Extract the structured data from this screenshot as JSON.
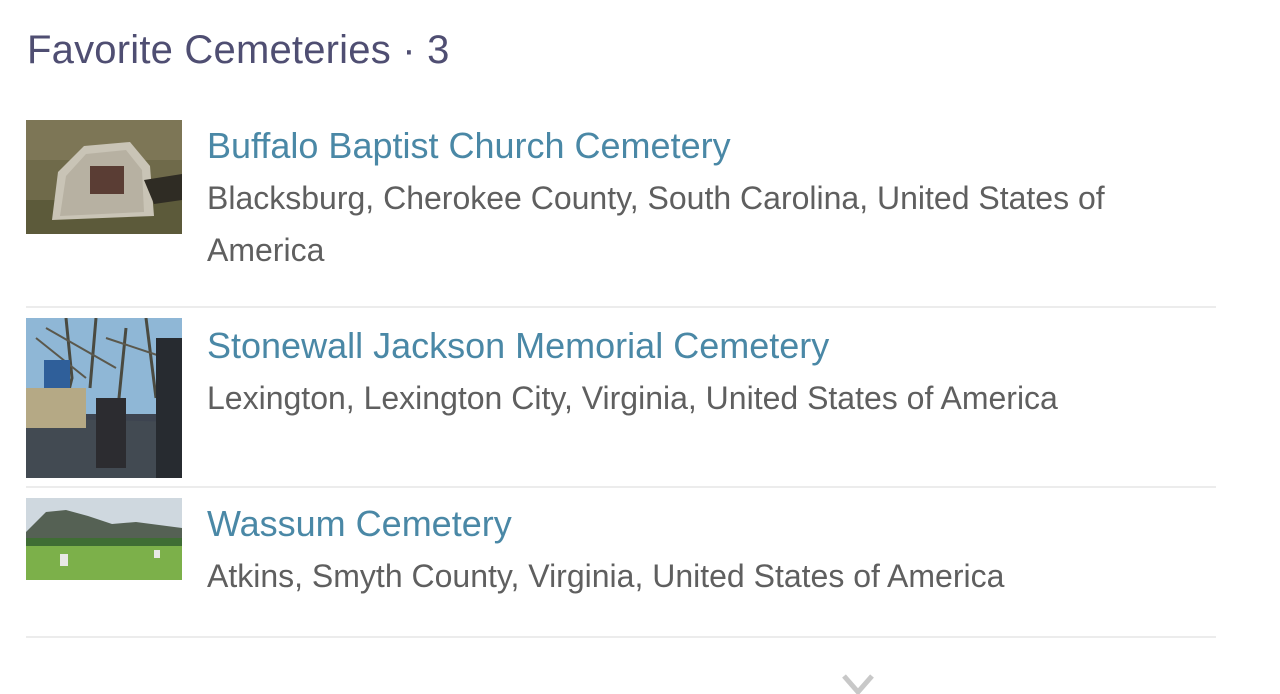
{
  "section": {
    "title": "Favorite Cemeteries",
    "separator": " · ",
    "count": "3"
  },
  "cemeteries": [
    {
      "name": "Buffalo Baptist Church Cemetery",
      "location": "Blacksburg, Cherokee County, South Carolina, United States of America",
      "thumbnail": "cemetery-photo"
    },
    {
      "name": "Stonewall Jackson Memorial Cemetery",
      "location": "Lexington, Lexington City, Virginia, United States of America",
      "thumbnail": "cemetery-photo"
    },
    {
      "name": "Wassum Cemetery",
      "location": "Atkins, Smyth County, Virginia, United States of America",
      "thumbnail": "cemetery-photo"
    }
  ],
  "icons": {
    "expand": "chevron-down-icon"
  },
  "colors": {
    "heading": "#4f4e72",
    "link": "#4a88a6",
    "location": "#5f5f5f",
    "divider": "#ececec"
  }
}
